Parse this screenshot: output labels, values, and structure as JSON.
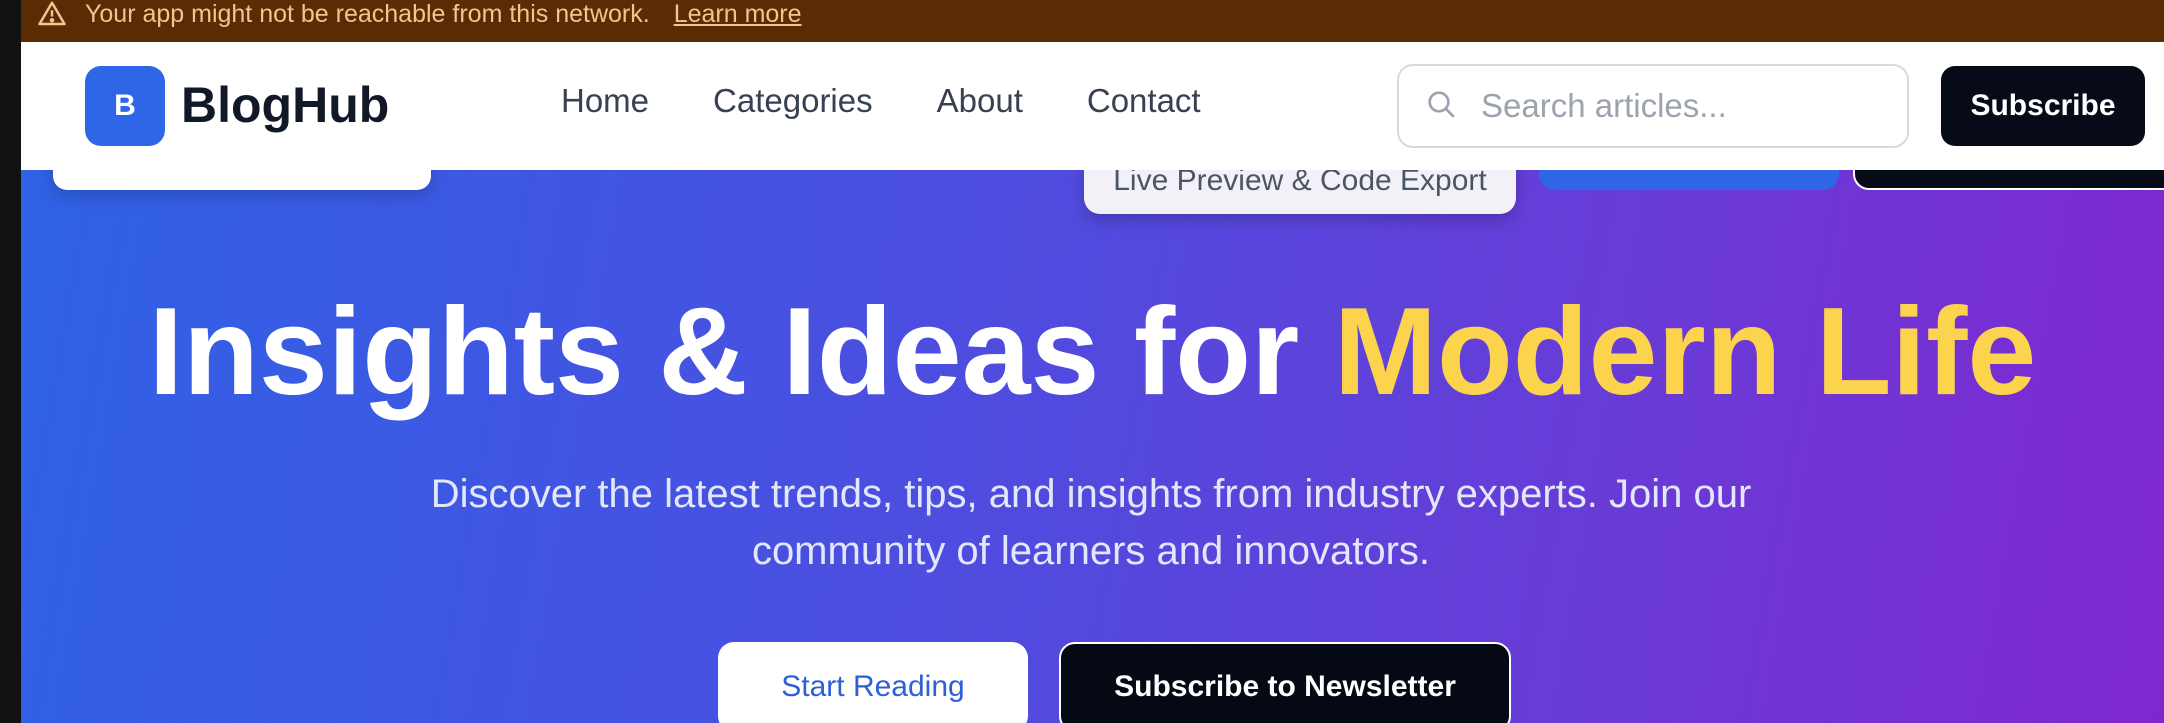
{
  "warning": {
    "text": "Your app might not be reachable from this network.",
    "link": "Learn more"
  },
  "nav": {
    "logo_letter": "B",
    "brand": "BlogHub",
    "links": [
      "Home",
      "Categories",
      "About",
      "Contact"
    ],
    "search_placeholder": "Search articles...",
    "subscribe": "Subscribe"
  },
  "overlay": {
    "preview_label": "Live Preview & Code Export"
  },
  "hero": {
    "headline_main": "Insights & Ideas for ",
    "headline_accent": "Modern Life",
    "subtitle_line1": "Discover the latest trends, tips, and insights from industry experts. Join our",
    "subtitle_line2": "community of learners and innovators.",
    "cta_primary": "Start Reading",
    "cta_secondary": "Subscribe to Newsletter"
  },
  "colors": {
    "accent_yellow": "#fcd34d",
    "brand_blue": "#2f66e8",
    "dark": "#070b17",
    "warning_bg": "#5a2c06"
  },
  "icons": [
    "warning-icon",
    "search-icon"
  ]
}
